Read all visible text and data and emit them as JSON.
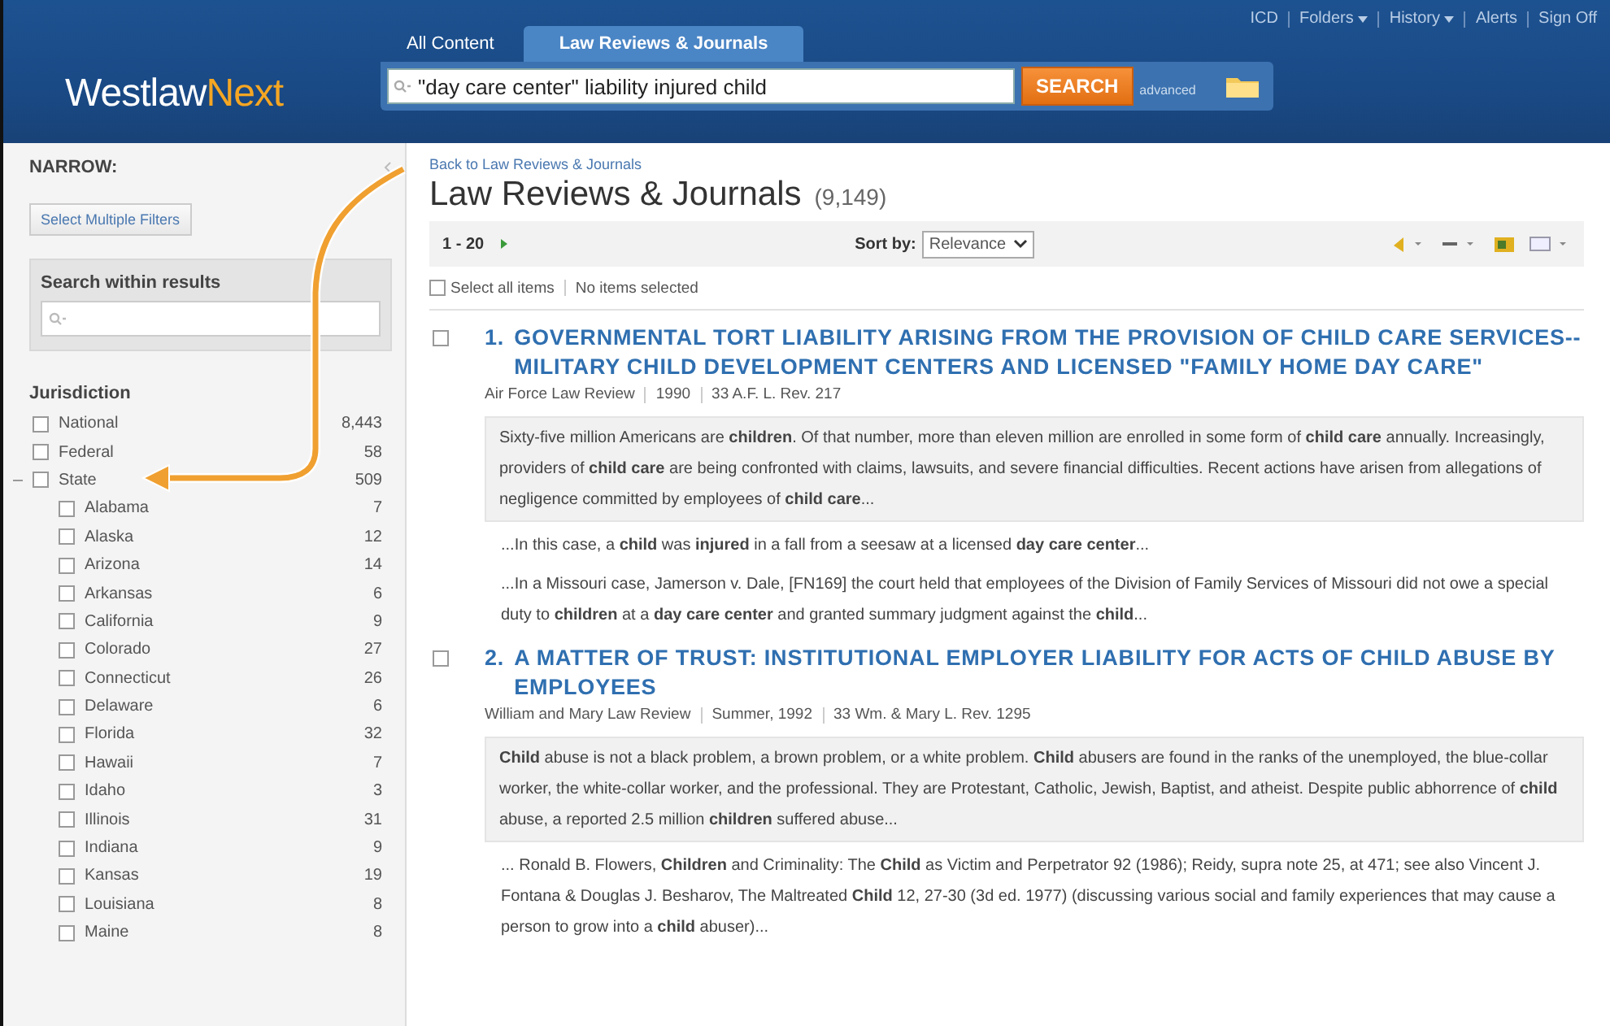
{
  "header": {
    "logo_main": "Westlaw",
    "logo_accent": "Next",
    "tabs": [
      {
        "label": "All Content",
        "selected": false
      },
      {
        "label": "Law Reviews & Journals",
        "selected": true
      }
    ],
    "top_links": [
      {
        "label": "ICD",
        "dropdown": false
      },
      {
        "label": "Folders",
        "dropdown": true
      },
      {
        "label": "History",
        "dropdown": true
      },
      {
        "label": "Alerts",
        "dropdown": false
      },
      {
        "label": "Sign Off",
        "dropdown": false
      }
    ],
    "search": {
      "value": "\"day care center\" liability injured child",
      "button": "SEARCH",
      "advanced": "advanced"
    }
  },
  "sidebar": {
    "title": "NARROW:",
    "multi_filter_button": "Select Multiple Filters",
    "search_label": "Search within results",
    "facet_title": "Jurisdiction",
    "items": [
      {
        "label": "National",
        "count": "8,443",
        "checked": false
      },
      {
        "label": "Federal",
        "count": "58",
        "checked": false
      },
      {
        "label": "State",
        "count": "509",
        "checked": false,
        "expanded": true,
        "children": [
          {
            "label": "Alabama",
            "count": "7",
            "checked": false
          },
          {
            "label": "Alaska",
            "count": "12",
            "checked": false
          },
          {
            "label": "Arizona",
            "count": "14",
            "checked": false
          },
          {
            "label": "Arkansas",
            "count": "6",
            "checked": false
          },
          {
            "label": "California",
            "count": "9",
            "checked": false
          },
          {
            "label": "Colorado",
            "count": "27",
            "checked": false
          },
          {
            "label": "Connecticut",
            "count": "26",
            "checked": false
          },
          {
            "label": "Delaware",
            "count": "6",
            "checked": false
          },
          {
            "label": "Florida",
            "count": "32",
            "checked": false
          },
          {
            "label": "Hawaii",
            "count": "7",
            "checked": false
          },
          {
            "label": "Idaho",
            "count": "3",
            "checked": false
          },
          {
            "label": "Illinois",
            "count": "31",
            "checked": false
          },
          {
            "label": "Indiana",
            "count": "9",
            "checked": false
          },
          {
            "label": "Kansas",
            "count": "19",
            "checked": false
          },
          {
            "label": "Louisiana",
            "count": "8",
            "checked": false
          },
          {
            "label": "Maine",
            "count": "8",
            "checked": false
          }
        ]
      }
    ]
  },
  "main": {
    "back_link": "Back to Law Reviews & Journals",
    "heading": "Law Reviews & Journals",
    "total": "(9,149)",
    "range": "1 - 20",
    "sort_label": "Sort by:",
    "sort_value": "Relevance",
    "select_all": {
      "label": "Select all items",
      "checked": false
    },
    "selection_status": "No items selected",
    "results": [
      {
        "number": "1.",
        "title": "GOVERNMENTAL TORT LIABILITY ARISING FROM THE PROVISION OF CHILD CARE SERVICES--MILITARY CHILD DEVELOPMENT CENTERS AND LICENSED \"FAMILY HOME DAY CARE\"",
        "selected": false,
        "meta": [
          "Air Force Law Review",
          "1990",
          "33 A.F. L. Rev. 217"
        ],
        "summary": "Sixty-five million Americans are **children**. Of that number, more than eleven million are enrolled in some form of **child care** annually. Increasingly, providers of **child care** are being confronted with claims, lawsuits, and severe financial difficulties. Recent actions have arisen from allegations of negligence committed by employees of **child care**...",
        "excerpts": [
          "...In this case, a **child** was **injured** in a fall from a seesaw at a licensed **day care center**...",
          "...In a Missouri case, Jamerson v. Dale, [FN169] the court held that employees of the Division of Family Services of Missouri did not owe a special duty to **children** at a **day care center** and granted summary judgment against the **child**..."
        ]
      },
      {
        "number": "2.",
        "title": "A MATTER OF TRUST: INSTITUTIONAL EMPLOYER LIABILITY FOR ACTS OF CHILD ABUSE BY EMPLOYEES",
        "selected": false,
        "meta": [
          "William and Mary Law Review",
          "Summer, 1992",
          "33 Wm. & Mary L. Rev. 1295"
        ],
        "summary": "**Child** abuse is not a black problem, a brown problem, or a white problem. **Child** abusers are found in the ranks of the unemployed, the blue-collar worker, the white-collar worker, and the professional. They are Protestant, Catholic, Jewish, Baptist, and atheist. Despite public abhorrence of **child** abuse, a reported 2.5 million **children** suffered abuse...",
        "excerpts": [
          "... Ronald B. Flowers, **Children** and Criminality: The **Child** as Victim and Perpetrator 92 (1986); Reidy, supra note 25, at 471; see also Vincent J. Fontana & Douglas J. Besharov, The Maltreated **Child** 12, 27-30 (3d ed. 1977) (discussing various social and family experiences that may cause a person to grow into a **child** abuser)..."
        ]
      }
    ]
  }
}
